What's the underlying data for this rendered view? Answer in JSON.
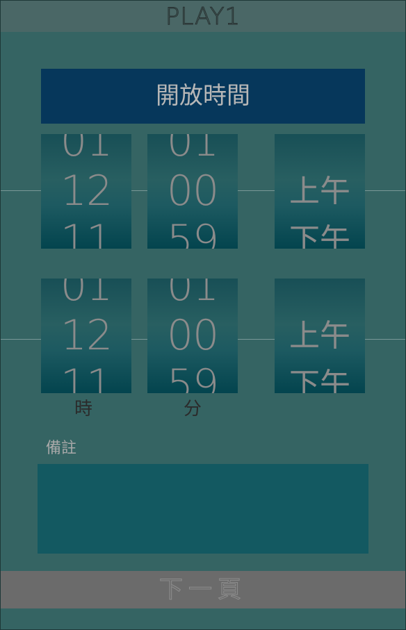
{
  "app": {
    "title": "PLAY1"
  },
  "header": {
    "title": "開放時間"
  },
  "open_time": {
    "hour": {
      "prev": "01",
      "current": "12",
      "next": "11"
    },
    "minute": {
      "prev": "01",
      "current": "00",
      "next": "59"
    },
    "ampm": {
      "current": "上午",
      "next": "下午"
    }
  },
  "close_time": {
    "hour": {
      "prev": "01",
      "current": "12",
      "next": "11"
    },
    "minute": {
      "prev": "01",
      "current": "00",
      "next": "59"
    },
    "ampm": {
      "current": "上午",
      "next": "下午"
    }
  },
  "labels": {
    "hour_unit": "時",
    "minute_unit": "分"
  },
  "notes": {
    "label": "備註",
    "value": ""
  },
  "footer": {
    "next_label": "下一頁"
  },
  "colors": {
    "background": "#356463",
    "header_bg": "#06375b",
    "picker_bg": "#1d5a61",
    "notes_bg": "#135961",
    "footer_bg": "#6b6b6b"
  }
}
